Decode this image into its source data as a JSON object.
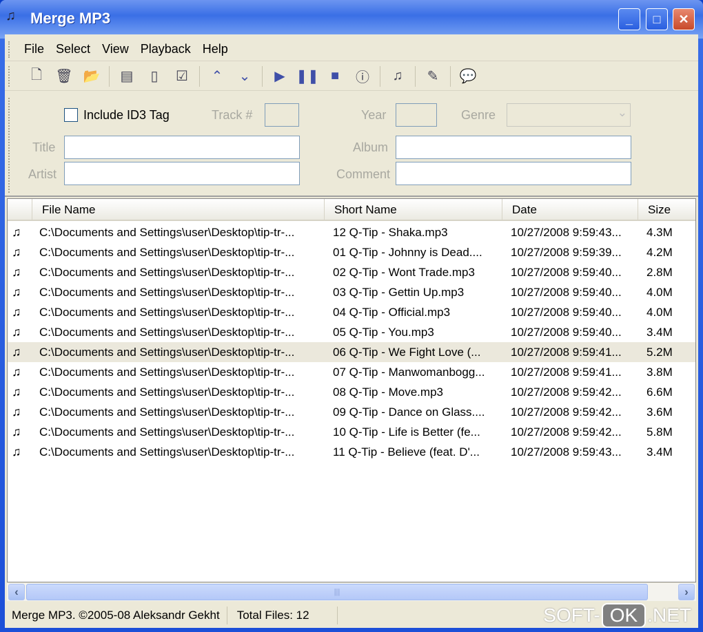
{
  "window": {
    "title": "Merge MP3"
  },
  "menu": [
    "File",
    "Select",
    "View",
    "Playback",
    "Help"
  ],
  "toolbar": [
    {
      "icon": "add-file-icon",
      "g": "🗋"
    },
    {
      "icon": "delete-icon",
      "g": "🗑"
    },
    {
      "icon": "open-folder-icon",
      "g": "📂"
    },
    "sep",
    {
      "icon": "select-all-icon",
      "g": "▤"
    },
    {
      "icon": "select-none-icon",
      "g": "▯"
    },
    {
      "icon": "invert-selection-icon",
      "g": "☑"
    },
    "sep",
    {
      "icon": "move-up-icon",
      "g": "⌃"
    },
    {
      "icon": "move-down-icon",
      "g": "⌄"
    },
    "sep",
    {
      "icon": "play-icon",
      "g": "▶"
    },
    {
      "icon": "pause-icon",
      "g": "❚❚"
    },
    {
      "icon": "stop-icon",
      "g": "■"
    },
    {
      "icon": "info-icon",
      "g": "ⓘ"
    },
    "sep",
    {
      "icon": "merge-icon",
      "g": "♫"
    },
    "sep",
    {
      "icon": "edit-tag-icon",
      "g": "✎"
    },
    "sep",
    {
      "icon": "help-balloon-icon",
      "g": "💬"
    }
  ],
  "form": {
    "include_id3": "Include ID3 Tag",
    "track": "Track #",
    "year": "Year",
    "genre": "Genre",
    "title": "Title",
    "album": "Album",
    "artist": "Artist",
    "comment": "Comment"
  },
  "columns": [
    "File Name",
    "Short Name",
    "Date",
    "Size"
  ],
  "rows": [
    [
      "C:\\Documents and Settings\\user\\Desktop\\tip-tr-...",
      "12 Q-Tip - Shaka.mp3",
      "10/27/2008 9:59:43...",
      "4.3M"
    ],
    [
      "C:\\Documents and Settings\\user\\Desktop\\tip-tr-...",
      "01 Q-Tip - Johnny is Dead....",
      "10/27/2008 9:59:39...",
      "4.2M"
    ],
    [
      "C:\\Documents and Settings\\user\\Desktop\\tip-tr-...",
      "02 Q-Tip - Wont Trade.mp3",
      "10/27/2008 9:59:40...",
      "2.8M"
    ],
    [
      "C:\\Documents and Settings\\user\\Desktop\\tip-tr-...",
      "03 Q-Tip - Gettin Up.mp3",
      "10/27/2008 9:59:40...",
      "4.0M"
    ],
    [
      "C:\\Documents and Settings\\user\\Desktop\\tip-tr-...",
      "04 Q-Tip - Official.mp3",
      "10/27/2008 9:59:40...",
      "4.0M"
    ],
    [
      "C:\\Documents and Settings\\user\\Desktop\\tip-tr-...",
      "05 Q-Tip - You.mp3",
      "10/27/2008 9:59:40...",
      "3.4M"
    ],
    [
      "C:\\Documents and Settings\\user\\Desktop\\tip-tr-...",
      "06 Q-Tip - We Fight  Love (...",
      "10/27/2008 9:59:41...",
      "5.2M"
    ],
    [
      "C:\\Documents and Settings\\user\\Desktop\\tip-tr-...",
      "07 Q-Tip - Manwomanbogg...",
      "10/27/2008 9:59:41...",
      "3.8M"
    ],
    [
      "C:\\Documents and Settings\\user\\Desktop\\tip-tr-...",
      "08 Q-Tip - Move.mp3",
      "10/27/2008 9:59:42...",
      "6.6M"
    ],
    [
      "C:\\Documents and Settings\\user\\Desktop\\tip-tr-...",
      "09 Q-Tip - Dance on Glass....",
      "10/27/2008 9:59:42...",
      "3.6M"
    ],
    [
      "C:\\Documents and Settings\\user\\Desktop\\tip-tr-...",
      "10 Q-Tip - Life is Better (fe...",
      "10/27/2008 9:59:42...",
      "5.8M"
    ],
    [
      "C:\\Documents and Settings\\user\\Desktop\\tip-tr-...",
      "11 Q-Tip - Believe (feat. D'...",
      "10/27/2008 9:59:43...",
      "3.4M"
    ]
  ],
  "selected_row": 6,
  "status": {
    "copyright": "Merge MP3. ©2005-08 Aleksandr Gekht",
    "total": "Total Files: 12"
  },
  "watermark": {
    "a": "SOFT-",
    "b": "OK",
    ".c": ".NET"
  }
}
